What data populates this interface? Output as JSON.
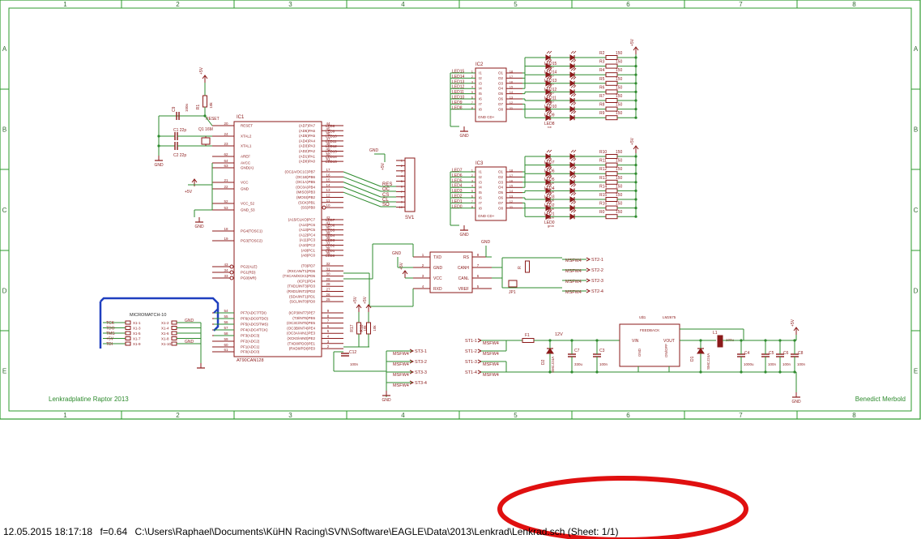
{
  "frame": {
    "cols": [
      "1",
      "2",
      "3",
      "4",
      "5",
      "6",
      "7",
      "8"
    ],
    "rows": [
      "A",
      "B",
      "C",
      "D",
      "E"
    ],
    "title_left": "Lenkradplatine Raptor 2013",
    "title_right": "Benedict Merbold"
  },
  "colors": {
    "border": "#2e9b2e",
    "wire": "#2e8b2e",
    "part": "#8b1a1a",
    "text": "#8b1a1a",
    "bus": "#1f3fbf",
    "mark": "#e01010"
  },
  "mcu": {
    "name": "IC1",
    "value": "AT90CAN128",
    "left_pins": [
      {
        "num": "20",
        "name": "RESET"
      },
      {
        "num": "24",
        "name": "XTAL2"
      },
      {
        "num": "23",
        "name": "XTAL1"
      },
      {
        "num": "62",
        "name": "AREF"
      },
      {
        "num": "64",
        "name": "AVCC"
      },
      {
        "num": "63",
        "name": "GND(A)"
      },
      {
        "num": "21",
        "name": "VCC"
      },
      {
        "num": "22",
        "name": "GND"
      },
      {
        "num": "52",
        "name": "VCC_52"
      },
      {
        "num": "53",
        "name": "GND_53"
      },
      {
        "num": "18",
        "name": "PG4(TOSC1)"
      },
      {
        "num": "19",
        "name": "PG3(TOSC2)"
      },
      {
        "num": "43",
        "name": "PG2(ALE)"
      },
      {
        "num": "34",
        "name": "PG1(RD)"
      },
      {
        "num": "33",
        "name": "PG0(WR)"
      },
      {
        "num": "54",
        "name": "PF7(ADC7/TDI)"
      },
      {
        "num": "55",
        "name": "PF6(ADC6/TDO)"
      },
      {
        "num": "56",
        "name": "PF5(ADC5/TMS)"
      },
      {
        "num": "57",
        "name": "PF4(ADC4/TCK)"
      },
      {
        "num": "58",
        "name": "PF3(ADC3)"
      },
      {
        "num": "59",
        "name": "PF2(ADC2)"
      },
      {
        "num": "60",
        "name": "PF1(ADC1)"
      },
      {
        "num": "61",
        "name": "PF0(ADC0)"
      }
    ],
    "right_pins": [
      {
        "num": "44",
        "name": "(AD7)PA7"
      },
      {
        "num": "45",
        "name": "(AD6)PA6"
      },
      {
        "num": "46",
        "name": "(AD5)PA5"
      },
      {
        "num": "47",
        "name": "(AD4)PA4"
      },
      {
        "num": "48",
        "name": "(AD3)PA3"
      },
      {
        "num": "49",
        "name": "(AD2)PA2"
      },
      {
        "num": "50",
        "name": "(AD1)PA1"
      },
      {
        "num": "51",
        "name": "(AD0)PA0"
      },
      {
        "num": "17",
        "name": "(OC2A/OC1C)PB7"
      },
      {
        "num": "16",
        "name": "(OC1B)PB6"
      },
      {
        "num": "15",
        "name": "(OC1A)PB5"
      },
      {
        "num": "14",
        "name": "(OC0A)PB4"
      },
      {
        "num": "13",
        "name": "(MISO)PB3"
      },
      {
        "num": "12",
        "name": "(MOSI)PB2"
      },
      {
        "num": "11",
        "name": "(SCK)PB1"
      },
      {
        "num": "10",
        "name": "(SS)PB0"
      },
      {
        "num": "42",
        "name": "(A15/CLKO)PC7"
      },
      {
        "num": "41",
        "name": "(A14)PC6"
      },
      {
        "num": "40",
        "name": "(A13)PC5"
      },
      {
        "num": "39",
        "name": "(A12)PC4"
      },
      {
        "num": "38",
        "name": "(A11)PC3"
      },
      {
        "num": "37",
        "name": "(A10)PC2"
      },
      {
        "num": "36",
        "name": "(A9)PC1"
      },
      {
        "num": "35",
        "name": "(A8)PC0"
      },
      {
        "num": "32",
        "name": "(T0)PD7"
      },
      {
        "num": "31",
        "name": "(RXCAN/T1)PD6"
      },
      {
        "num": "30",
        "name": "(TXCAN/XCK1)PD5"
      },
      {
        "num": "29",
        "name": "(ICP1)PD4"
      },
      {
        "num": "28",
        "name": "(TXD1/INT3)PD3"
      },
      {
        "num": "27",
        "name": "(RXD1/INT2)PD2"
      },
      {
        "num": "26",
        "name": "(SDA/INT1)PD1"
      },
      {
        "num": "25",
        "name": "(SCL/INT0)PD0"
      },
      {
        "num": "9",
        "name": "(ICP3/INT7)PE7"
      },
      {
        "num": "8",
        "name": "(T3/INT6)PE6"
      },
      {
        "num": "7",
        "name": "(OC3C/INT5)PE5"
      },
      {
        "num": "6",
        "name": "(OC3B/INT4)PE4"
      },
      {
        "num": "5",
        "name": "(OC3A/AIN1)PE3"
      },
      {
        "num": "4",
        "name": "(XCK0/AIN0)PE2"
      },
      {
        "num": "3",
        "name": "(TXD0/PDO)PE1"
      },
      {
        "num": "2",
        "name": "(RXD0/PDI)PE0"
      }
    ],
    "pa_nets": [
      "LED8",
      "LED9",
      "LED10",
      "LED11",
      "LED12",
      "LED13",
      "LED14",
      "LED15"
    ],
    "pc_nets": [
      "LED7",
      "LED6",
      "LED5",
      "LED4",
      "LED3",
      "LED2",
      "LED1",
      "LED0"
    ]
  },
  "osc": {
    "c9": "C9",
    "c9v": "100n",
    "c1": "C1",
    "c1v": "22p",
    "c2": "C2",
    "c2v": "22p",
    "q1": "Q1",
    "q1v": "16M",
    "r1": "R1",
    "r1v": "10k",
    "reset": "RESET",
    "gnd": "GND",
    "vcc": "+5V"
  },
  "spi": {
    "name": "SV1",
    "nets": [
      "RES",
      "OC",
      "CS",
      "CL",
      "SO"
    ],
    "pins": [
      "1",
      "2",
      "3",
      "4",
      "5",
      "6",
      "7",
      "8",
      "9",
      "10"
    ],
    "gnd": "GND",
    "vcc": "+5V"
  },
  "micromatch": {
    "title": "MICROMATCH-10",
    "left": [
      {
        "net": "TCK",
        "pin": "X1-1"
      },
      {
        "net": "TDO",
        "pin": "X1-3"
      },
      {
        "net": "TMS",
        "pin": "X1-5"
      },
      {
        "net": "+5V",
        "pin": "X1-7"
      },
      {
        "net": "TDI",
        "pin": "X1-9"
      }
    ],
    "right": [
      {
        "pin": "X1-2",
        "net": "GND"
      },
      {
        "pin": "X1-4",
        "net": ""
      },
      {
        "pin": "X1-6",
        "net": ""
      },
      {
        "pin": "X1-8",
        "net": ""
      },
      {
        "pin": "X1-10",
        "net": "GND"
      }
    ]
  },
  "ic2": {
    "name": "IC2",
    "in_nets": [
      "LED15",
      "LED14",
      "LED13",
      "LED12",
      "LED11",
      "LED10",
      "LED9",
      "LED8"
    ],
    "in_pins": [
      "1",
      "2",
      "3",
      "4",
      "5",
      "6",
      "7",
      "8"
    ],
    "in_names": [
      "I1",
      "I2",
      "I3",
      "I4",
      "I5",
      "I6",
      "I7",
      "I8"
    ],
    "out_names": [
      "O1",
      "O2",
      "O3",
      "O4",
      "O5",
      "O6",
      "O7",
      "O8"
    ],
    "out_pins": [
      "18",
      "17",
      "16",
      "15",
      "14",
      "13",
      "12",
      "11"
    ],
    "gnd_label": "GND CD+",
    "leds": [
      {
        "name": "LED15",
        "color": "blau"
      },
      {
        "name": "LED14",
        "color": "blau"
      },
      {
        "name": "LED13",
        "color": "blau"
      },
      {
        "name": "LED12",
        "color": "blau"
      },
      {
        "name": "LED11",
        "color": "blau"
      },
      {
        "name": "LED10",
        "color": "rot"
      },
      {
        "name": "LED9",
        "color": "rot"
      },
      {
        "name": "LED8",
        "color": "rot"
      }
    ],
    "resistors": [
      {
        "name": "R2",
        "value": "150"
      },
      {
        "name": "R3",
        "value": "150"
      },
      {
        "name": "R4",
        "value": "150"
      },
      {
        "name": "R5",
        "value": "150"
      },
      {
        "name": "R6",
        "value": "150"
      },
      {
        "name": "R7",
        "value": "150"
      },
      {
        "name": "R8",
        "value": "150"
      },
      {
        "name": "R9",
        "value": "150"
      }
    ]
  },
  "ic3": {
    "name": "IC3",
    "in_nets": [
      "LED7",
      "LED6",
      "LED5",
      "LED4",
      "LED3",
      "LED2",
      "LED1",
      "LED0"
    ],
    "in_pins": [
      "1",
      "2",
      "3",
      "4",
      "5",
      "6",
      "7",
      "8"
    ],
    "in_names": [
      "I1",
      "I2",
      "I3",
      "I4",
      "I5",
      "I6",
      "I7",
      "I8"
    ],
    "out_names": [
      "O1",
      "O2",
      "O3",
      "O4",
      "O5",
      "O6",
      "O7",
      "O8"
    ],
    "out_pins": [
      "18",
      "17",
      "16",
      "15",
      "14",
      "13",
      "12",
      "11"
    ],
    "gnd_label": "GND CD+",
    "leds": [
      {
        "name": "LED7",
        "color": "rot"
      },
      {
        "name": "LED6",
        "color": "rot"
      },
      {
        "name": "LED5",
        "color": "grün"
      },
      {
        "name": "LED4",
        "color": "grün"
      },
      {
        "name": "LED3",
        "color": "grün"
      },
      {
        "name": "LED2",
        "color": "grün"
      },
      {
        "name": "LED1",
        "color": "grün"
      },
      {
        "name": "LED0",
        "color": "grün"
      }
    ],
    "resistors": [
      {
        "name": "R10",
        "value": "150"
      },
      {
        "name": "R11",
        "value": "150"
      },
      {
        "name": "R12",
        "value": "150"
      },
      {
        "name": "R13",
        "value": "150"
      },
      {
        "name": "R14",
        "value": "150"
      },
      {
        "name": "R15",
        "value": "150"
      },
      {
        "name": "R16",
        "value": "150"
      },
      {
        "name": "R0",
        "value": "150"
      }
    ]
  },
  "can": {
    "left": [
      {
        "num": "1",
        "name": "TXD"
      },
      {
        "num": "2",
        "name": "GND"
      },
      {
        "num": "3",
        "name": "VCC"
      },
      {
        "num": "4",
        "name": "RXD"
      }
    ],
    "right": [
      {
        "num": "8",
        "name": "RS"
      },
      {
        "num": "7",
        "name": "CANH"
      },
      {
        "num": "6",
        "name": "CANL"
      },
      {
        "num": "5",
        "name": "VREF"
      }
    ],
    "jp": "JP1",
    "r": "R",
    "gnd": "GND",
    "vcc": "+5V",
    "outputs": [
      {
        "net": "MSFW4",
        "label": "ST2-1"
      },
      {
        "net": "MSFW4",
        "label": "ST2-2"
      },
      {
        "net": "MSFW4",
        "label": "ST2-3"
      },
      {
        "net": "MSFW4",
        "label": "ST2-4"
      }
    ]
  },
  "st3": {
    "r17": "R17",
    "r18": "R18",
    "rv": "10k",
    "c12": "C12",
    "c12v": "100n",
    "vcc": "+5V",
    "gnd": "GND",
    "outputs": [
      {
        "net": "MSFW4",
        "label": "ST3-1"
      },
      {
        "net": "MSFW4",
        "label": "ST3-2"
      },
      {
        "net": "MSFW4",
        "label": "ST3-3"
      },
      {
        "net": "MSFW4",
        "label": "ST3-4"
      }
    ]
  },
  "power": {
    "inputs": [
      {
        "label": "ST1-1",
        "net": "MSFW4"
      },
      {
        "label": "ST1-2",
        "net": "MSFW4"
      },
      {
        "label": "ST1-3",
        "net": "MSFW4"
      },
      {
        "label": "ST1-4",
        "net": "MSFW4"
      }
    ],
    "f1": "F1",
    "v12": "12V",
    "d2": "D2",
    "d2v": "SMCJ24A",
    "c7": "C7",
    "c7v": "330u",
    "c3": "C3",
    "c3v": "100n",
    "reg": "LM2675",
    "u": "U$1",
    "vin": "VIN",
    "fb": "FEEDBACK",
    "vout": "VOUT",
    "gndp": "GND",
    "onoff": "ON/OFF",
    "d1": "D1",
    "d1v": "SMCJ24A",
    "l1": "L1",
    "l1v": "100u",
    "caps": [
      {
        "name": "C4",
        "value": "1000u"
      },
      {
        "name": "C5",
        "value": "100n"
      },
      {
        "name": "C6",
        "value": "100n"
      },
      {
        "name": "C8",
        "value": "100n"
      }
    ],
    "vcc": "+5V",
    "gnd": "GND"
  },
  "footer": {
    "date": "12.05.2015 18:17:18",
    "scale": "f=0.64",
    "path": "C:\\Users\\Raphael\\Documents\\KüHN Racing\\SVN\\Software\\EAGLE\\Data\\2013\\Lenkrad\\Lenkrad.sch (Sheet: 1/1)"
  }
}
